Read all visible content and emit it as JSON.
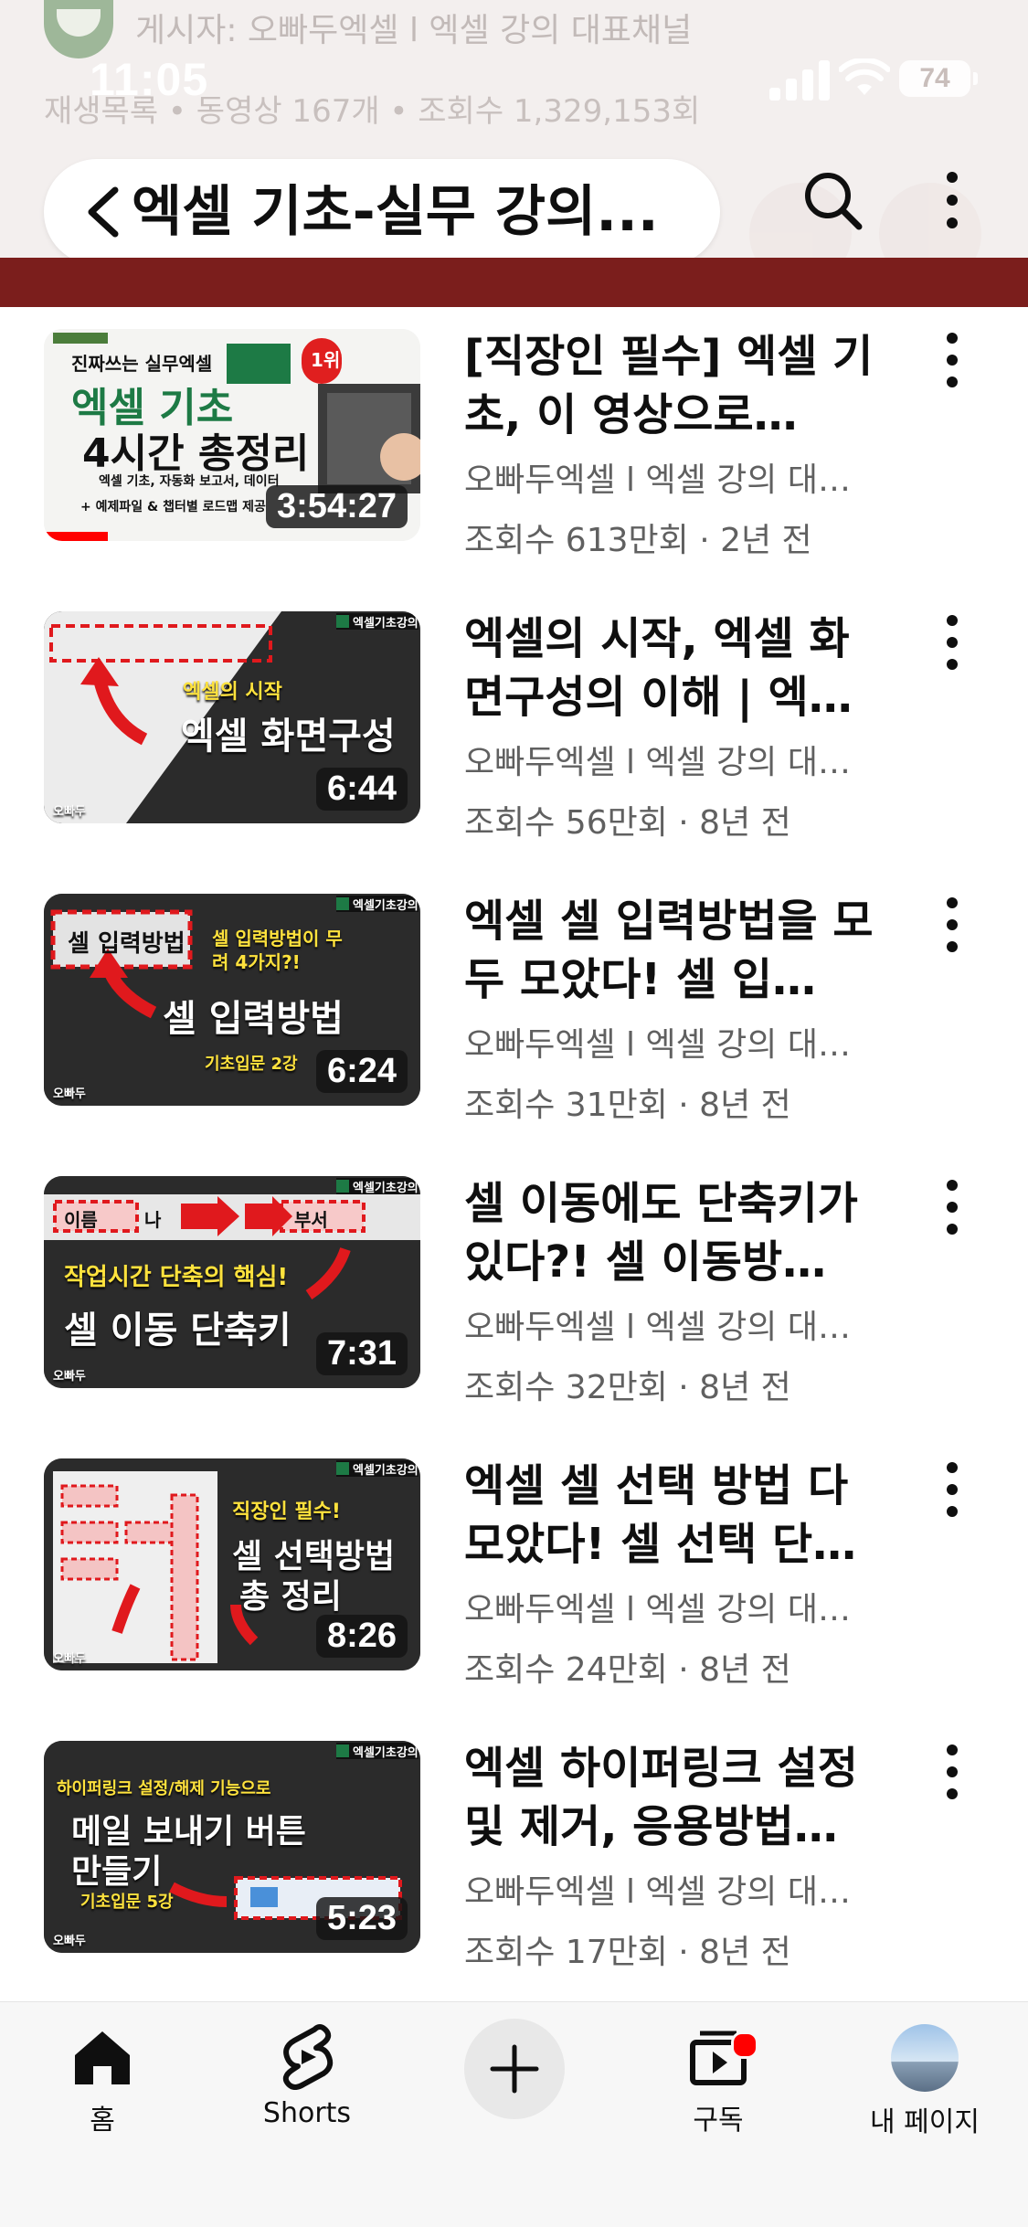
{
  "status_bar": {
    "time": "11:05",
    "battery": "74"
  },
  "header": {
    "poster_line": "게시자: 오빠두엑셀 l 엑셀 강의 대표채널",
    "meta_line": "재생목록 • 동영상 167개 • 조회수 1,329,153회",
    "search_title": "엑셀 기초-실무 강의..."
  },
  "videos": [
    {
      "title": "[직장인 필수] 엑셀 기초, 이 영상으로…",
      "channel": "오빠두엑셀 l 엑셀 강의 대…",
      "stats": "조회수 613만회 · 2년 전",
      "duration": "3:54:27",
      "thumb_lines": [
        "진짜쓰는 실무엑셀",
        "엑셀 기초",
        "4시간 총정리",
        "엑셀 기초, 자동화 보고서, 데이터",
        "+ 예제파일 & 챕터별 로드맵 제공"
      ],
      "badge": "1위"
    },
    {
      "title": "엑셀의 시작, 엑셀 화면구성의 이해 | 엑…",
      "channel": "오빠두엑셀 l 엑셀 강의 대…",
      "stats": "조회수 56만회 · 8년 전",
      "duration": "6:44",
      "thumb_lines": [
        "엑셀의 시작",
        "엑셀 화면구성",
        "엑셀기초강의",
        "오빠두"
      ]
    },
    {
      "title": "엑셀 셀 입력방법을 모두 모았다! 셀 입…",
      "channel": "오빠두엑셀 l 엑셀 강의 대…",
      "stats": "조회수 31만회 · 8년 전",
      "duration": "6:24",
      "thumb_lines": [
        "셀 입력방법",
        "셀 입력방법이 무려 4가지?!",
        "셀 입력방법",
        "기초입문 2강",
        "엑셀기초강의",
        "오빠두"
      ]
    },
    {
      "title": "셀 이동에도 단축키가 있다?! 셀 이동방…",
      "channel": "오빠두엑셀 l 엑셀 강의 대…",
      "stats": "조회수 32만회 · 8년 전",
      "duration": "7:31",
      "thumb_lines": [
        "이름",
        "나",
        "부서",
        "작업시간 단축의 핵심!",
        "셀 이동 단축키",
        "엑셀기초강의",
        "오빠두"
      ]
    },
    {
      "title": "엑셀 셀 선택 방법 다 모았다! 셀 선택 단…",
      "channel": "오빠두엑셀 l 엑셀 강의 대…",
      "stats": "조회수 24만회 · 8년 전",
      "duration": "8:26",
      "thumb_lines": [
        "직장인 필수!",
        "셀 선택방법",
        "총 정리",
        "엑셀기초강의",
        "오빠두"
      ]
    },
    {
      "title": "엑셀 하이퍼링크 설정 및 제거, 응용방법…",
      "channel": "오빠두엑셀 l 엑셀 강의 대…",
      "stats": "조회수 17만회 · 8년 전",
      "duration": "5:23",
      "thumb_lines": [
        "하이퍼링크 설정/해제 기능으로",
        "메일 보내기 버튼",
        "만들기",
        "기초입문 5강",
        "엑셀기초강의",
        "오빠두"
      ]
    }
  ],
  "nav": {
    "home": "홈",
    "shorts": "Shorts",
    "subscriptions": "구독",
    "my_page": "내 페이지"
  },
  "colors": {
    "accent_red": "#ff0000",
    "band_maroon": "#7b1e1c",
    "excel_green": "#1d7a45"
  }
}
